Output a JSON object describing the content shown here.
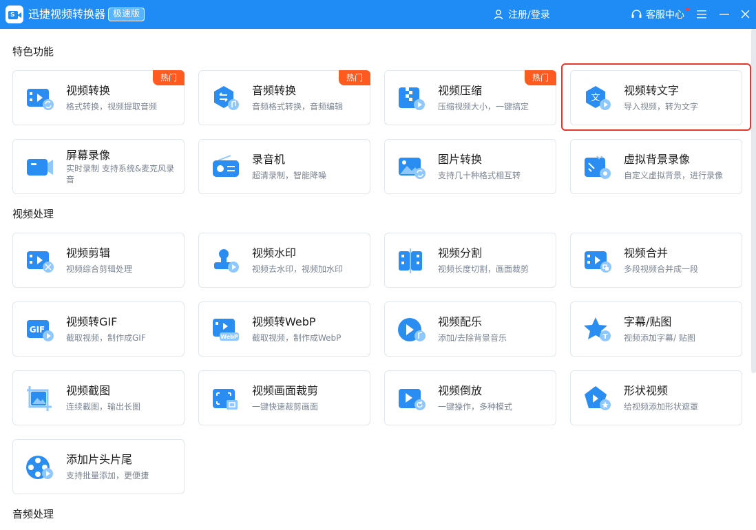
{
  "app": {
    "title": "迅捷视频转换器",
    "edition_badge": "极速版",
    "login_label": "注册/登录",
    "support_label": "客服中心"
  },
  "colors": {
    "primary": "#1f8cf5",
    "hot": "#ff5a1f",
    "highlight": "#e5372b"
  },
  "sections": {
    "featured": "特色功能",
    "video": "视频处理",
    "audio": "音频处理"
  },
  "hot_label": "热门",
  "cards": {
    "video_convert": {
      "name": "视频转换",
      "desc": "格式转换，视频提取音频",
      "icon": "video-convert-icon"
    },
    "audio_convert": {
      "name": "音频转换",
      "desc": "音频格式转换，音频编辑",
      "icon": "audio-convert-icon"
    },
    "video_compress": {
      "name": "视频压缩",
      "desc": "压缩视频大小，一键搞定",
      "icon": "video-compress-icon"
    },
    "video_to_text": {
      "name": "视频转文字",
      "desc": "导入视频，转为文字",
      "icon": "video-to-text-icon"
    },
    "screen_record": {
      "name": "屏幕录像",
      "desc": "实时录制 支持系统&麦克风录音",
      "icon": "screen-record-icon"
    },
    "voice_recorder": {
      "name": "录音机",
      "desc": "超清录制，智能降噪",
      "icon": "recorder-icon"
    },
    "image_convert": {
      "name": "图片转换",
      "desc": "支持几十种格式相互转",
      "icon": "image-convert-icon"
    },
    "virtual_bg": {
      "name": "虚拟背景录像",
      "desc": "自定义虚拟背景，进行录像",
      "icon": "virtual-background-icon"
    },
    "video_edit": {
      "name": "视频剪辑",
      "desc": "视频综合剪辑处理",
      "icon": "video-edit-icon"
    },
    "video_watermark": {
      "name": "视频水印",
      "desc": "视频去水印，视频加水印",
      "icon": "watermark-icon"
    },
    "video_split": {
      "name": "视频分割",
      "desc": "视频长度切割，画面裁剪",
      "icon": "video-split-icon"
    },
    "video_merge": {
      "name": "视频合并",
      "desc": "多段视频合并成一段",
      "icon": "video-merge-icon"
    },
    "video_gif": {
      "name": "视频转GIF",
      "desc": "截取视频，制作成GIF",
      "icon": "gif-icon",
      "icon_text": "GIF"
    },
    "video_webp": {
      "name": "视频转WebP",
      "desc": "截取视频，制作成WebP",
      "icon": "webp-icon",
      "icon_text": "WebP"
    },
    "video_music": {
      "name": "视频配乐",
      "desc": "添加/去除背景音乐",
      "icon": "music-icon"
    },
    "subtitle": {
      "name": "字幕/贴图",
      "desc": "视频添加字幕/ 贴图",
      "icon": "subtitle-star-icon",
      "icon_text": "T"
    },
    "video_screenshot": {
      "name": "视频截图",
      "desc": "连续截图，输出长图",
      "icon": "screenshot-icon"
    },
    "video_crop": {
      "name": "视频画面裁剪",
      "desc": "一键快速裁剪画面",
      "icon": "crop-icon"
    },
    "video_reverse": {
      "name": "视频倒放",
      "desc": "一键操作，多种模式",
      "icon": "reverse-icon"
    },
    "shape_video": {
      "name": "形状视频",
      "desc": "给视频添加形状遮罩",
      "icon": "shape-icon"
    },
    "intro_outro": {
      "name": "添加片头片尾",
      "desc": "支持批量添加，更便捷",
      "icon": "film-reel-icon"
    }
  }
}
